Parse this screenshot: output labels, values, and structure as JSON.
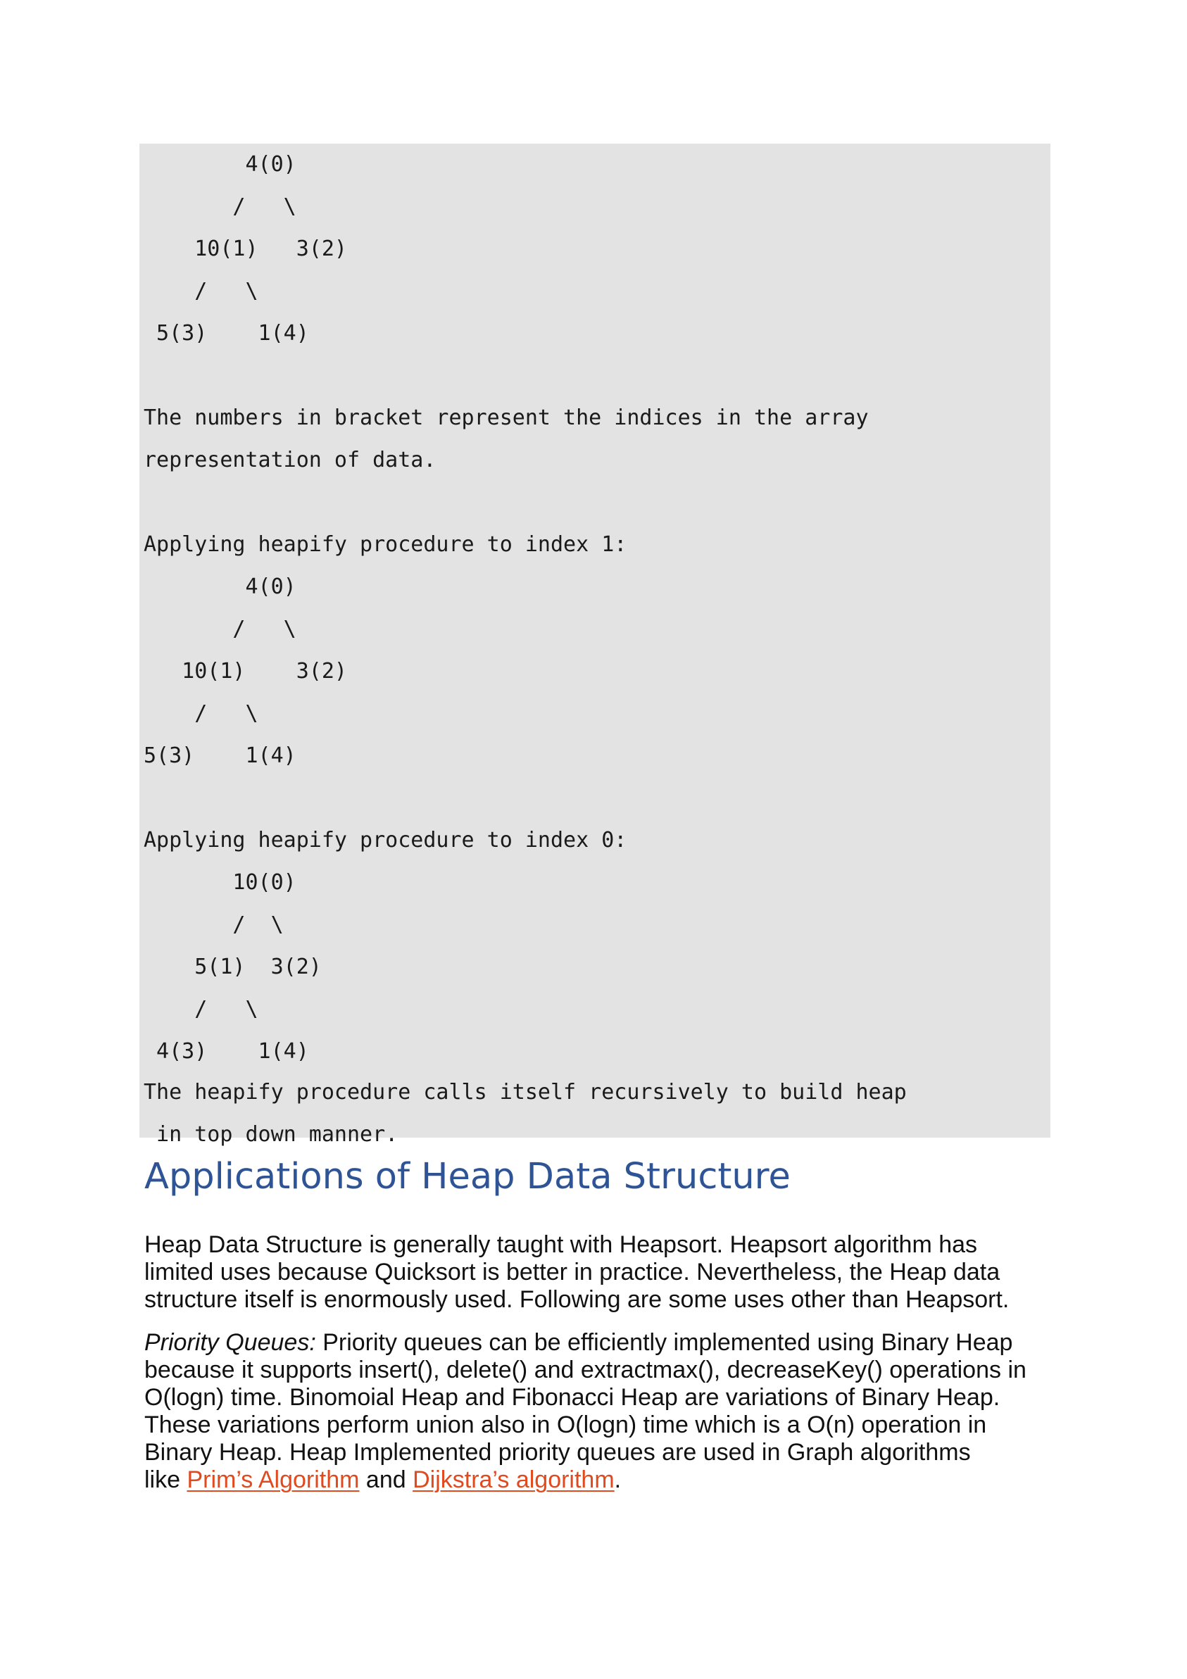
{
  "code_block": {
    "lines": [
      "        4(0)",
      "       /   \\",
      "    10(1)   3(2)",
      "    /   \\",
      " 5(3)    1(4)",
      "",
      "The numbers in bracket represent the indices in the array",
      "representation of data.",
      "",
      "Applying heapify procedure to index 1:",
      "        4(0)",
      "       /   \\",
      "   10(1)    3(2)",
      "    /   \\",
      "5(3)    1(4)",
      "",
      "Applying heapify procedure to index 0:",
      "       10(0)",
      "       /  \\",
      "    5(1)  3(2)",
      "    /   \\",
      " 4(3)    1(4)",
      "The heapify procedure calls itself recursively to build heap",
      " in top down manner."
    ]
  },
  "section": {
    "heading": "Applications of Heap Data Structure",
    "intro_lines": [
      "Heap Data Structure is generally taught with Heapsort. Heapsort algorithm has",
      "limited uses because Quicksort is better in practice. Nevertheless, the Heap data",
      "structure itself is enormously used. Following are some uses other than Heapsort."
    ],
    "pq": {
      "term": "Priority Queues:",
      "first_line_rest": " Priority queues can be efficiently implemented using Binary Heap",
      "middle_lines": [
        "because it supports insert(), delete() and extractmax(), decreaseKey() operations in",
        "O(logn) time. Binomoial Heap and Fibonacci Heap are variations of Binary Heap.",
        "These variations perform union also in O(logn) time which is a O(n) operation in",
        "Binary Heap. Heap Implemented priority queues are used in Graph algorithms"
      ],
      "last_prefix": "like ",
      "link_prims": "Prim’s Algorithm",
      "joiner": " and ",
      "link_dijkstra": "Dijkstra’s algorithm",
      "suffix": "."
    }
  }
}
